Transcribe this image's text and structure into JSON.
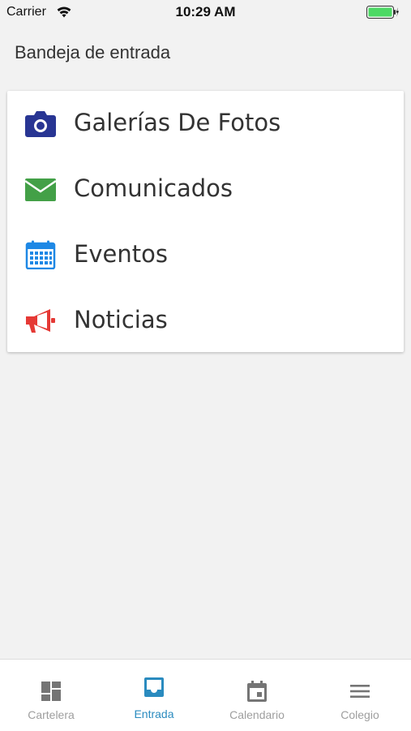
{
  "status_bar": {
    "carrier": "Carrier",
    "time": "10:29 AM",
    "wifi_icon": "wifi-icon",
    "battery_icon": "battery-charging-icon",
    "battery_color": "#4cd964"
  },
  "header": {
    "title": "Bandeja de entrada"
  },
  "menu": {
    "items": [
      {
        "label": "Galerías De Fotos",
        "icon": "camera-icon",
        "color": "#283593"
      },
      {
        "label": "Comunicados",
        "icon": "envelope-icon",
        "color": "#43a047"
      },
      {
        "label": "Eventos",
        "icon": "calendar-icon",
        "color": "#1e88e5"
      },
      {
        "label": "Noticias",
        "icon": "megaphone-icon",
        "color": "#e53935"
      }
    ]
  },
  "tab_bar": {
    "active_color": "#2a8bbf",
    "inactive_color": "#9e9e9e",
    "tabs": [
      {
        "label": "Cartelera",
        "icon": "dashboard-icon",
        "active": false
      },
      {
        "label": "Entrada",
        "icon": "inbox-icon",
        "active": true
      },
      {
        "label": "Calendario",
        "icon": "calendar-icon",
        "active": false
      },
      {
        "label": "Colegio",
        "icon": "menu-icon",
        "active": false
      }
    ]
  }
}
